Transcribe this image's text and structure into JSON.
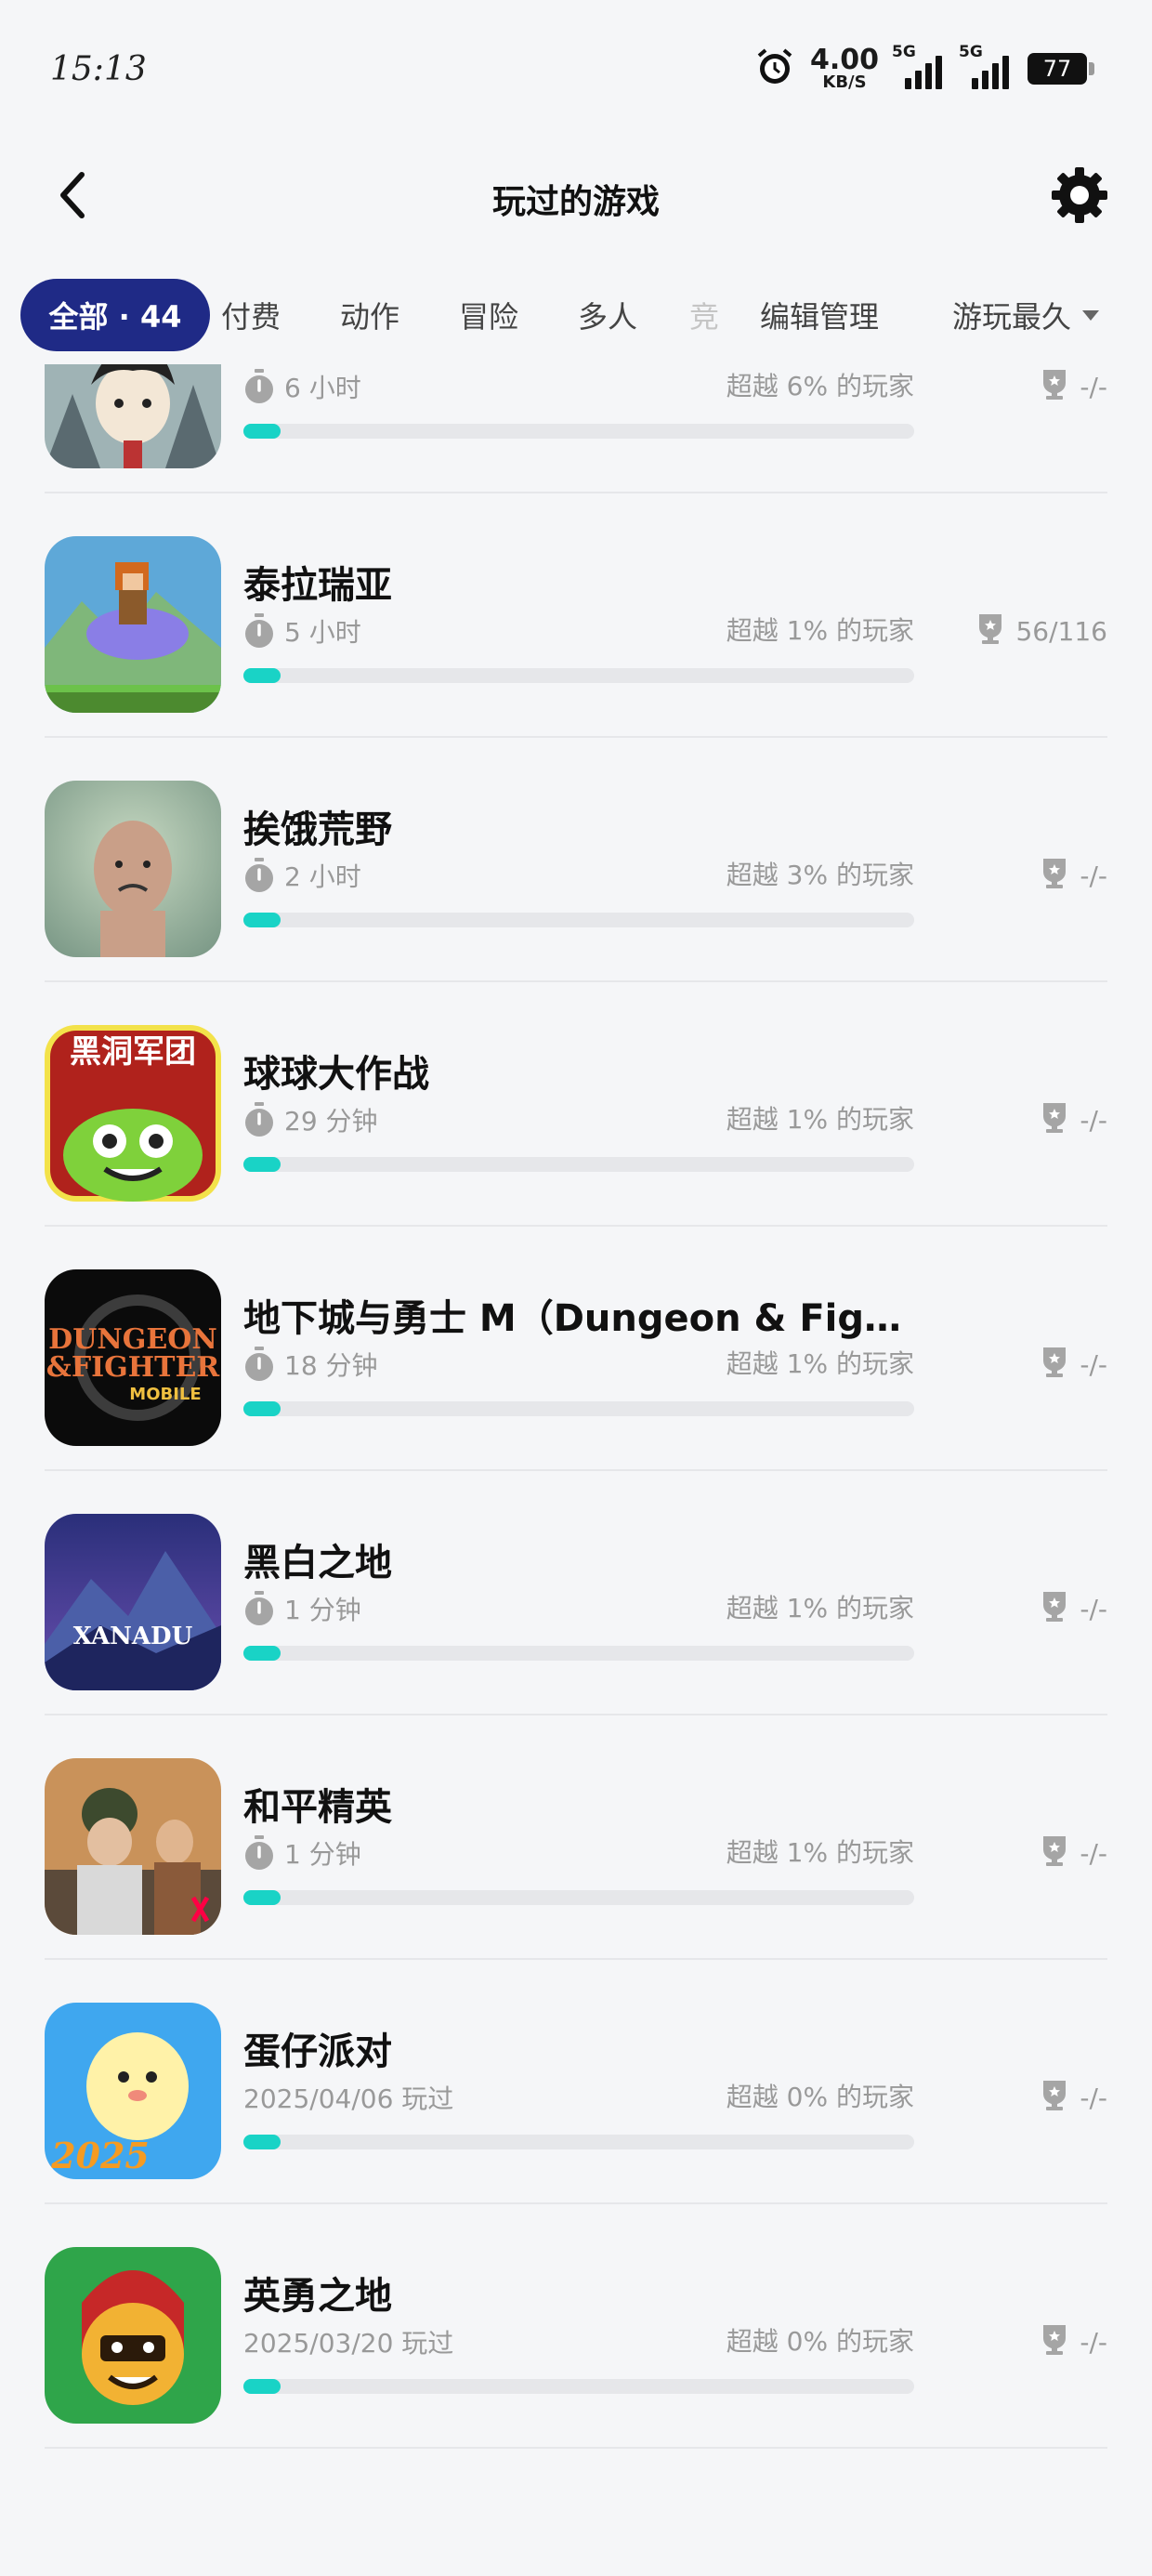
{
  "status_bar": {
    "time": "15:13",
    "speed_value": "4.00",
    "speed_unit": "KB/S",
    "net_label_1": "5G",
    "net_label_2": "5G",
    "battery": "77",
    "icons": [
      "alarm-icon",
      "signal-icon",
      "battery-icon"
    ]
  },
  "header": {
    "title": "玩过的游戏",
    "back_icon": "chevron-left-icon",
    "settings_icon": "gear-icon"
  },
  "tabs": [
    {
      "label": "全部 · 44",
      "active": true
    },
    {
      "label": "付费",
      "active": false
    },
    {
      "label": "动作",
      "active": false
    },
    {
      "label": "冒险",
      "active": false
    },
    {
      "label": "多人",
      "active": false
    },
    {
      "label": "竞",
      "active": false
    },
    {
      "label": "编辑管理",
      "active": false
    },
    {
      "label": "游玩最久",
      "active": false
    }
  ],
  "colors": {
    "accent": "#1f2a86",
    "progress": "#19d3c6",
    "background": "#f5f6f8"
  },
  "games": [
    {
      "name": "",
      "meta": "6 小时",
      "rank": "超越 6% 的玩家",
      "achievements": "-/-",
      "progress": 0.05,
      "thumb": "cartoon-character"
    },
    {
      "name": "泰拉瑞亚",
      "meta": "5 小时",
      "rank": "超越 1% 的玩家",
      "achievements": "56/116",
      "progress": 0.05,
      "thumb": "pixel-hero"
    },
    {
      "name": "挨饿荒野",
      "meta": "2 小时",
      "rank": "超越 3% 的玩家",
      "achievements": "-/-",
      "progress": 0.05,
      "thumb": "survivor"
    },
    {
      "name": "球球大作战",
      "meta": "29 分钟",
      "rank": "超越 1% 的玩家",
      "achievements": "-/-",
      "progress": 0.05,
      "thumb": "green-blob"
    },
    {
      "name": "地下城与勇士 M（Dungeon & Fighter M…",
      "meta": "18 分钟",
      "rank": "超越 1% 的玩家",
      "achievements": "-/-",
      "progress": 0.05,
      "thumb": "dnf-logo"
    },
    {
      "name": "黑白之地",
      "meta": "1 分钟",
      "rank": "超越 1% 的玩家",
      "achievements": "-/-",
      "progress": 0.05,
      "thumb": "xanadu"
    },
    {
      "name": "和平精英",
      "meta": "1 分钟",
      "rank": "超越 1% 的玩家",
      "achievements": "-/-",
      "progress": 0.05,
      "thumb": "soldiers"
    },
    {
      "name": "蛋仔派对",
      "meta": "2025/04/06 玩过",
      "rank": "超越 0% 的玩家",
      "achievements": "-/-",
      "progress": 0.05,
      "thumb": "eggy"
    },
    {
      "name": "英勇之地",
      "meta": "2025/03/20 玩过",
      "rank": "超越 0% 的玩家",
      "achievements": "-/-",
      "progress": 0.05,
      "thumb": "spartan"
    }
  ],
  "thumb_texts": {
    "blackhole": "黑洞军团",
    "dnf_line1": "DUNGEON",
    "dnf_line2": "&FIGHTER",
    "dnf_line3": "MOBILE",
    "xanadu": "XANADU",
    "eggy_year": "2025"
  }
}
